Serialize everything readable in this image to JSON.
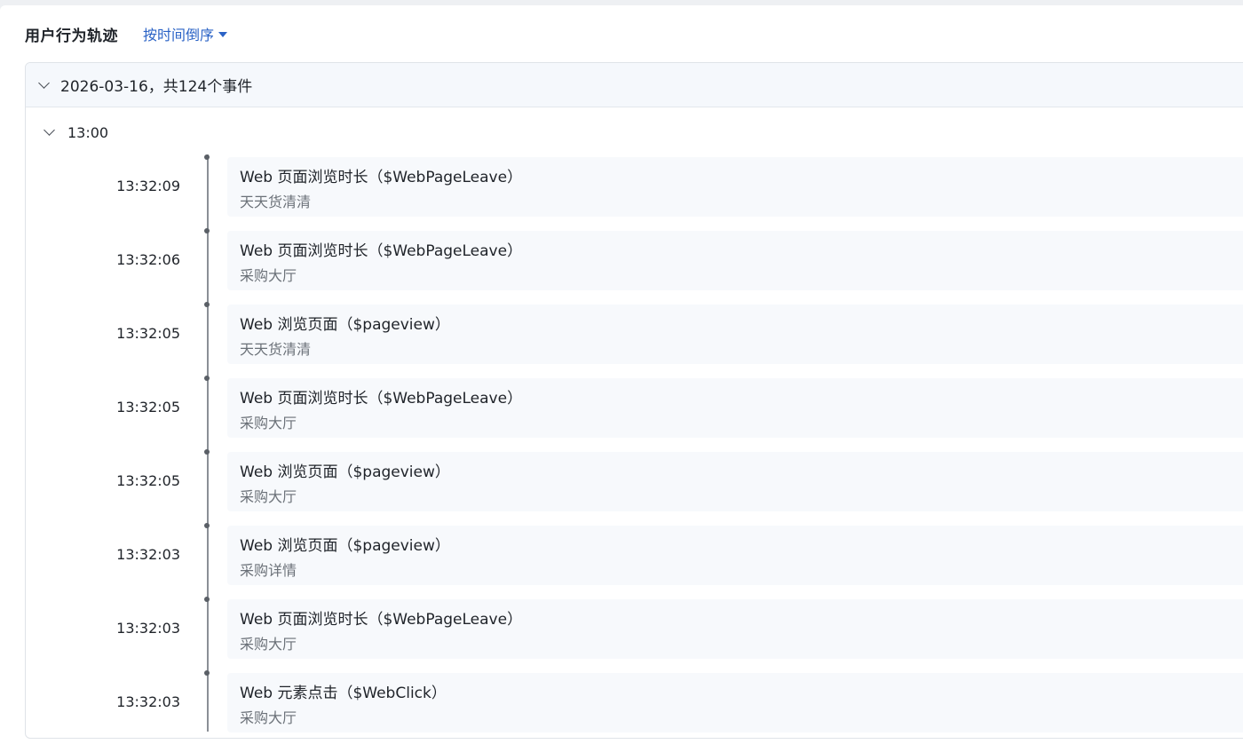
{
  "header": {
    "title": "用户行为轨迹",
    "sort_label": "按时间倒序"
  },
  "day": {
    "label": "2026-03-16，共124个事件"
  },
  "hour": {
    "label": "13:00"
  },
  "events": [
    {
      "time": "13:32:09",
      "name": "Web 页面浏览时长（$WebPageLeave）",
      "page": "天天货清清"
    },
    {
      "time": "13:32:06",
      "name": "Web 页面浏览时长（$WebPageLeave）",
      "page": "采购大厅"
    },
    {
      "time": "13:32:05",
      "name": "Web 浏览页面（$pageview）",
      "page": "天天货清清"
    },
    {
      "time": "13:32:05",
      "name": "Web 页面浏览时长（$WebPageLeave）",
      "page": "采购大厅"
    },
    {
      "time": "13:32:05",
      "name": "Web 浏览页面（$pageview）",
      "page": "采购大厅"
    },
    {
      "time": "13:32:03",
      "name": "Web 浏览页面（$pageview）",
      "page": "采购详情"
    },
    {
      "time": "13:32:03",
      "name": "Web 页面浏览时长（$WebPageLeave）",
      "page": "采购大厅"
    },
    {
      "time": "13:32:03",
      "name": "Web 元素点击（$WebClick）",
      "page": "采购大厅"
    }
  ],
  "colors": {
    "link": "#2b63c6",
    "day_header_bg": "#f5f8fc",
    "event_bg": "#f7f9fc",
    "secondary_text": "#6b7178"
  },
  "icons": {
    "sort": "caret-down-icon",
    "day_toggle": "chevron-down-icon",
    "hour_toggle": "chevron-down-icon"
  }
}
